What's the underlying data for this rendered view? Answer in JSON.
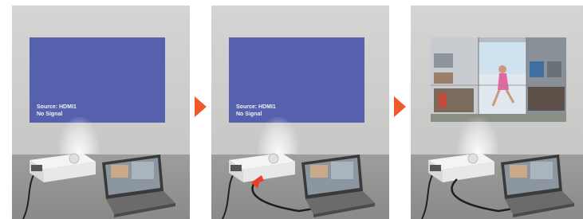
{
  "steps": [
    {
      "source_line": "Source: HDMI1",
      "status_line": "No Signal"
    },
    {
      "source_line": "Source: HDMI1",
      "status_line": "No Signal"
    }
  ],
  "colors": {
    "screen_blue": "#5561ad",
    "arrow_orange": "#f05a28",
    "wall": "#cfcfcd",
    "floor": "#939391"
  },
  "icons": [
    "projector-icon",
    "laptop-icon",
    "hdmi-cable-icon",
    "step-arrow-icon"
  ]
}
